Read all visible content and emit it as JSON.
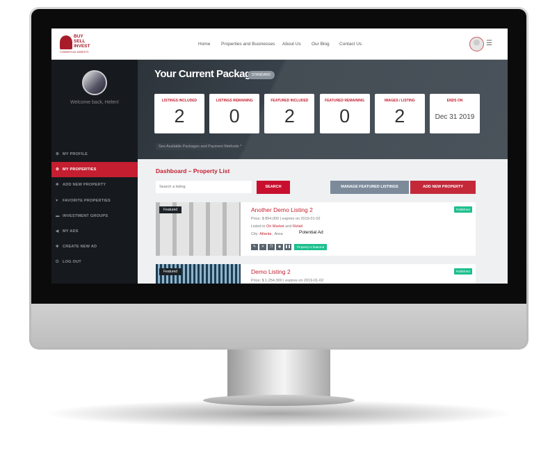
{
  "header": {
    "logo": "BUY SELL INVEST COMMERCIAL MARKETS",
    "nav": [
      "Home",
      "Properties and Businesses",
      "About Us",
      "Our Blog",
      "Contact Us"
    ]
  },
  "sidebar": {
    "welcome": "Welcome back, Helen!",
    "items": [
      {
        "label": "MY PROFILE",
        "icon": "gear-icon",
        "active": false
      },
      {
        "label": "MY PROPERTIES",
        "icon": "gear-icon",
        "active": true
      },
      {
        "label": "ADD NEW PROPERTY",
        "icon": "plus-icon",
        "active": false
      },
      {
        "label": "FAVORITE PROPERTIES",
        "icon": "heart-icon",
        "active": false
      },
      {
        "label": "INVESTMENT GROUPS",
        "icon": "users-icon",
        "active": false
      },
      {
        "label": "MY ADS",
        "icon": "megaphone-icon",
        "active": false
      },
      {
        "label": "CREATE NEW AD",
        "icon": "plus-icon",
        "active": false
      },
      {
        "label": "LOG OUT",
        "icon": "power-icon",
        "active": false
      }
    ]
  },
  "package": {
    "title": "Your Current Package:",
    "badge": "STANDARD",
    "cards": [
      {
        "label": "LISTINGS INCLUDED",
        "value": "2"
      },
      {
        "label": "LISTINGS REMAINING",
        "value": "0"
      },
      {
        "label": "FEATURED INCLUDED",
        "value": "2"
      },
      {
        "label": "FEATURED REMAINING",
        "value": "0"
      },
      {
        "label": "IMAGES / LISTING",
        "value": "2"
      },
      {
        "label": "ENDS ON",
        "value": "Dec 31 2019"
      }
    ],
    "link": "See Available Packages and Payment Methods ^"
  },
  "dashboard": {
    "title": "Dashboard – Property List",
    "search_placeholder": "Search a listing",
    "search_button": "SEARCH",
    "manage_button": "MANAGE FEATURED LISTINGS",
    "add_button": "ADD NEW PROPERTY"
  },
  "listings": [
    {
      "title": "Another Demo Listing 2",
      "featured": "Featured",
      "status": "Published",
      "price": "Price: $ 854,000 | expires on 2019-01-02",
      "listed_prefix": "Listed in ",
      "category1": "On Market",
      "and": " and ",
      "category2": "Retail",
      "city_prefix": "City: ",
      "city": "Atlanta",
      "area": " , Area:",
      "ad": "Potential Ad",
      "featured_badge": "Property is featured"
    },
    {
      "title": "Demo Listing 2",
      "featured": "Featured",
      "status": "Published",
      "price": "Price: $ 1,254,300 | expires on 2019-01-02"
    }
  ],
  "colors": {
    "accent": "#c41e30",
    "sidebar": "#16191e",
    "published": "#1dbf8e",
    "manage": "#7d8a9a"
  }
}
